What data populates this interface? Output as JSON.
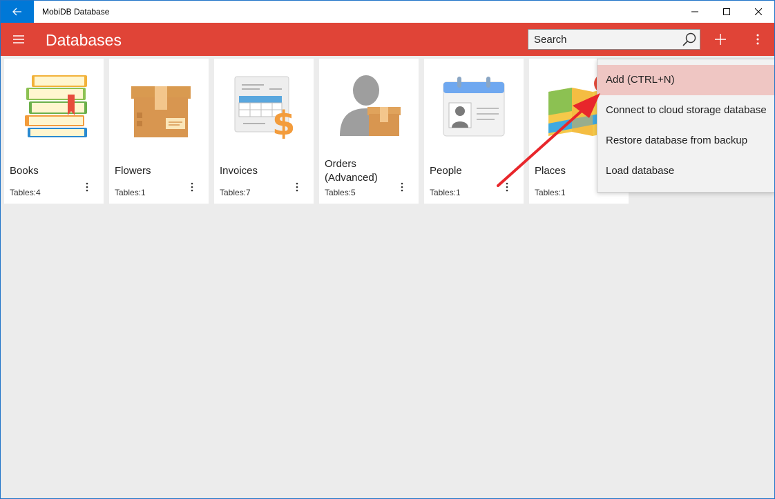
{
  "window": {
    "title": "MobiDB Database",
    "controls": [
      "minimize",
      "maximize",
      "close"
    ]
  },
  "appbar": {
    "title": "Databases",
    "search_placeholder": "Search",
    "accent_color": "#e04437"
  },
  "databases": [
    {
      "name": "Books",
      "tables": "Tables:4",
      "icon": "books-icon"
    },
    {
      "name": "Flowers",
      "tables": "Tables:1",
      "icon": "box-icon"
    },
    {
      "name": "Invoices",
      "tables": "Tables:7",
      "icon": "invoice-icon"
    },
    {
      "name": "Orders (Advanced)",
      "tables": "Tables:5",
      "icon": "person-box-icon"
    },
    {
      "name": "People",
      "tables": "Tables:1",
      "icon": "id-card-icon"
    },
    {
      "name": "Places",
      "tables": "Tables:1",
      "icon": "map-icon"
    }
  ],
  "menu": {
    "items": [
      {
        "label": "Add (CTRL+N)",
        "highlighted": true
      },
      {
        "label": "Connect to cloud storage database"
      },
      {
        "label": "Restore database from backup"
      },
      {
        "label": "Load database"
      }
    ]
  }
}
